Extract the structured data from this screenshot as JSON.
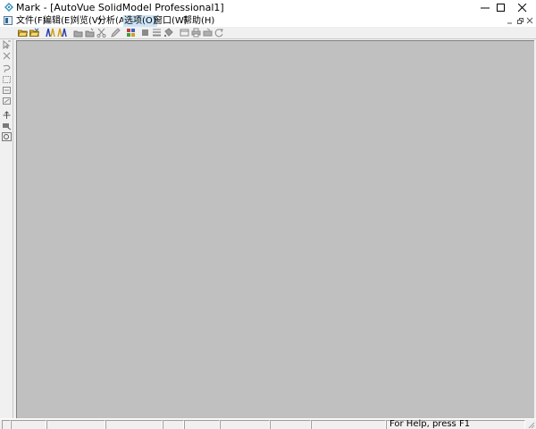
{
  "window": {
    "title": "Mark - [AutoVue SolidModel Professional1]"
  },
  "menu": {
    "items": [
      {
        "label": "文件(F)"
      },
      {
        "label": "编辑(E)"
      },
      {
        "label": "浏览(V)"
      },
      {
        "label": "分析(A)"
      },
      {
        "label": "选项(O)"
      },
      {
        "label": "窗口(W)"
      },
      {
        "label": "帮助(H)"
      }
    ],
    "selected_index": 4
  },
  "toolbar": {
    "icons": [
      "open-folder-icon",
      "open-folder-alt-icon",
      "mark-icon",
      "mark-alt-icon",
      "save-icon",
      "save-as-icon",
      "cut-icon",
      "pen-icon",
      "color-grid-icon",
      "fill-icon",
      "line-style-icon",
      "bucket-icon",
      "frame-icon",
      "print-icon",
      "stamp-icon",
      "rotate-icon"
    ]
  },
  "sidebar": {
    "icons": [
      "select-arrow-icon",
      "select-arrow-alt-icon",
      "select-cross-icon",
      "lasso-icon",
      "box-select-icon",
      "box-select-alt-icon",
      "box-select-2-icon",
      "crosshair-icon",
      "zoom-icon",
      "zoom-window-icon"
    ]
  },
  "statusbar": {
    "help_text": "For Help, press F1"
  },
  "colors": {
    "workspace": "#c0c0c0",
    "chrome": "#f0f0f0",
    "menu_highlight": "#cce4f7"
  }
}
